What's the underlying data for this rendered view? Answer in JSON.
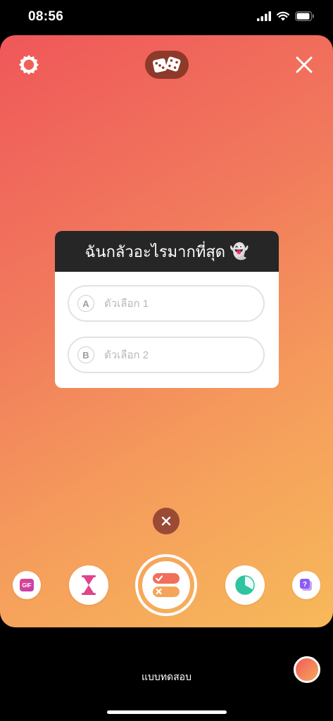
{
  "status": {
    "time": "08:56"
  },
  "quiz": {
    "question": "ฉันกลัวอะไรมากที่สุด",
    "emoji": "👻",
    "options": [
      {
        "letter": "A",
        "placeholder": "ตัวเลือก 1"
      },
      {
        "letter": "B",
        "placeholder": "ตัวเลือก 2"
      }
    ]
  },
  "tray": {
    "gif_label": "GIF",
    "mode_label": "แบบทดสอบ"
  },
  "colors": {
    "canvas_gradient": [
      "#f0575a",
      "#f7b95a"
    ],
    "card_header": "#262626",
    "dice_pill": "#8e3a2a",
    "hourglass": "#e0458b",
    "poll": "#2ec4a0"
  },
  "icons": [
    "signal-icon",
    "wifi-icon",
    "battery-icon",
    "settings-icon",
    "dice-icon",
    "close-icon",
    "ghost-emoji",
    "gif-icon",
    "hourglass-icon",
    "quiz-icon",
    "poll-icon",
    "question-sticker-icon"
  ]
}
